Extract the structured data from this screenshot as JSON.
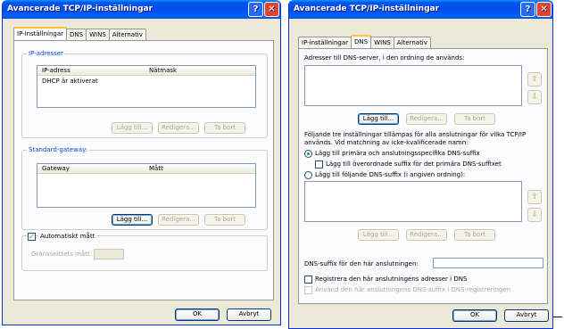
{
  "left": {
    "title": "Avancerade TCP/IP-inställningar",
    "tabs": [
      "IP-inställningar",
      "DNS",
      "WINS",
      "Alternativ"
    ],
    "ip_group": {
      "legend": "IP-adresser",
      "columns": [
        "IP-adress",
        "Nätmask"
      ],
      "rows": [
        "DHCP är aktiverat"
      ],
      "buttons": [
        "Lägg till...",
        "Redigera...",
        "Ta bort"
      ]
    },
    "gw_group": {
      "legend": "Standard-gateway:",
      "columns": [
        "Gateway",
        "Mått"
      ],
      "buttons": [
        "Lägg till...",
        "Redigera...",
        "Ta bort"
      ]
    },
    "metric": {
      "auto_label": "Automatiskt mått",
      "iface_label": "Gränssnittets mått:"
    },
    "ok": "OK",
    "cancel": "Avbryt"
  },
  "right": {
    "title": "Avancerade TCP/IP-inställningar",
    "tabs": [
      "IP-inställningar",
      "DNS",
      "WINS",
      "Alternativ"
    ],
    "dns_list_label": "Adresser till DNS-server, i den ordning de används:",
    "dns_buttons": [
      "Lägg till...",
      "Redigera...",
      "Ta bort"
    ],
    "info_line1": "Följande tre inställningar tillämpas för alla anslutningar för vilka TCP/IP",
    "info_line2": "används. Vid matchning av icke-kvalificerade namn:",
    "radio1": "Lägg till primära och anslutningsspecifika DNS-suffix",
    "check_parent": "Lägg till överordnade suffix för det primära DNS-suffixet",
    "radio2": "Lägg till följande DNS-suffix (i angiven ordning):",
    "suffix_buttons": [
      "Lägg till...",
      "Redigera...",
      "Ta bort"
    ],
    "conn_suffix_label": "DNS-suffix för den här anslutningen:",
    "register_label": "Registrera den här anslutningens adresser i DNS",
    "use_suffix_label": "Använd den här anslutningens DNS-suffix i DNS-registreringen",
    "ok": "OK",
    "cancel": "Avbryt"
  }
}
